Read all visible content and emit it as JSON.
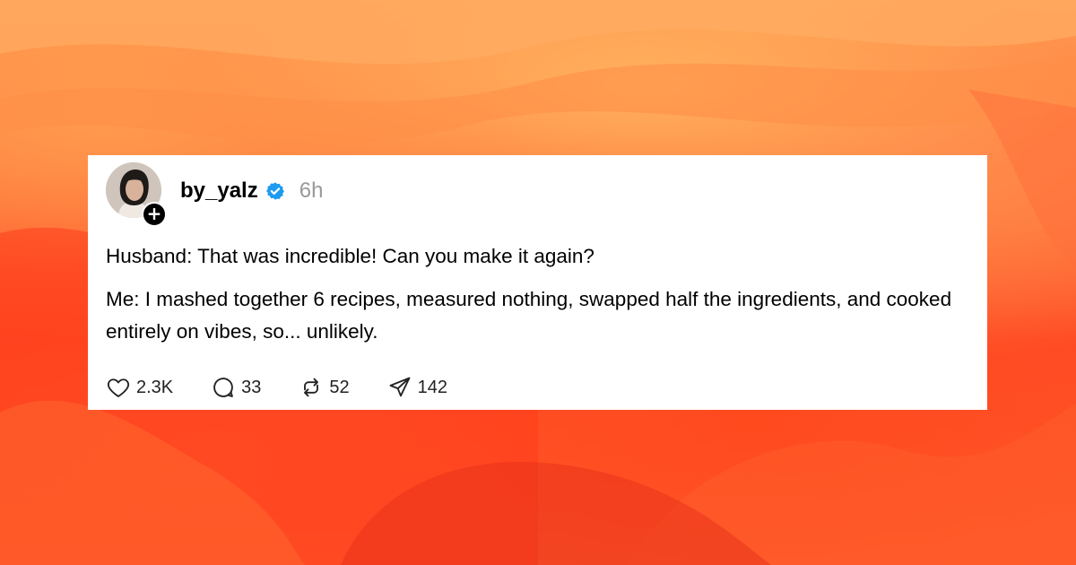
{
  "post": {
    "username": "by_yalz",
    "verified": true,
    "time": "6h",
    "paragraphs": [
      "Husband: That was incredible! Can you make it again?",
      "Me: I mashed together 6 recipes, measured nothing, swapped half the ingredients, and cooked entirely on vibes, so... unlikely."
    ]
  },
  "actions": {
    "likes": "2.3K",
    "replies": "33",
    "reposts": "52",
    "shares": "142"
  },
  "colors": {
    "verified_badge": "#1d9bf0",
    "background_orange": "#ff7a3c",
    "background_red": "#ff4a24"
  },
  "icons": [
    "heart-icon",
    "comment-icon",
    "repost-icon",
    "send-icon",
    "verified-badge-icon",
    "plus-icon"
  ]
}
